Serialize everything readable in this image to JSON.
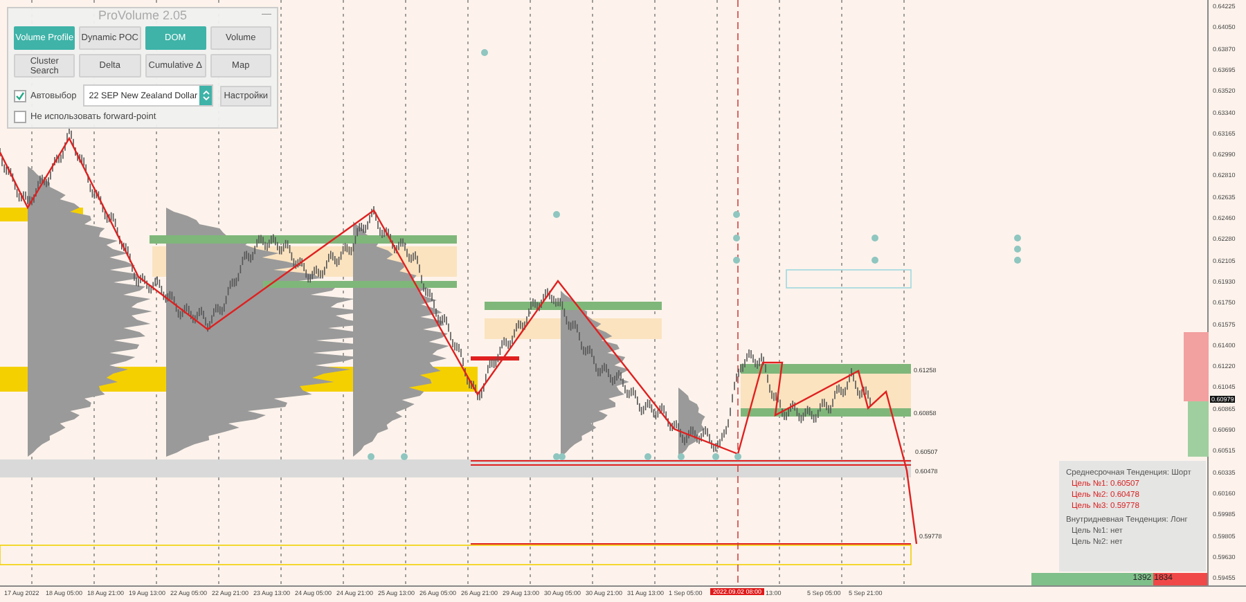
{
  "panel": {
    "title": "ProVolume 2.05",
    "minimize": "—",
    "buttons": [
      {
        "label": "Volume Profile",
        "on": true
      },
      {
        "label": "Dynamic POC",
        "on": false
      },
      {
        "label": "DOM",
        "on": true
      },
      {
        "label": "Volume",
        "on": false
      },
      {
        "label": "Cluster Search",
        "on": false
      },
      {
        "label": "Delta",
        "on": false
      },
      {
        "label": "Cumulative Δ",
        "on": false
      },
      {
        "label": "Map",
        "on": false
      }
    ],
    "auto_select": {
      "label": "Автовыбор",
      "checked": true
    },
    "instrument": {
      "value": "22 SEP New Zealand Dollar"
    },
    "settings_button": "Настройки",
    "forward_point": {
      "label": "Не использовать forward-point",
      "checked": false
    }
  },
  "chart_labels": [
    "0.61258",
    "0.60858",
    "0.60507",
    "0.60478",
    "0.59778"
  ],
  "tendency": [
    {
      "kind": "heading",
      "text": "Среднесрочная Тенденция: Шорт"
    },
    {
      "kind": "target",
      "text": "Цель №1: 0.60507"
    },
    {
      "kind": "target",
      "text": "Цель №2: 0.60478"
    },
    {
      "kind": "target",
      "text": "Цель №3: 0.59778"
    },
    {
      "kind": "heading",
      "text": "Внутридневная Тенденция: Лонг"
    },
    {
      "kind": "empty",
      "text": "Цель №1: нет"
    },
    {
      "kind": "empty",
      "text": "Цель №2: нет"
    }
  ],
  "volume_balance": {
    "buy": "1392",
    "sell": "1834",
    "level": 0.69
  },
  "price_axis": [
    "0.64225",
    "0.64050",
    "0.63870",
    "0.63695",
    "0.63520",
    "0.63340",
    "0.63165",
    "0.62990",
    "0.62810",
    "0.62635",
    "0.62460",
    "0.62280",
    "0.62105",
    "0.61930",
    "0.61750",
    "0.61575",
    "0.61400",
    "0.61220",
    "0.61045",
    "0.60865",
    "0.60690",
    "0.60515",
    "0.60335",
    "0.60160",
    "0.59985",
    "0.59805",
    "0.59630",
    "0.59455"
  ],
  "current_price": "0.60979",
  "time_axis": [
    {
      "label": "17 Aug 2022",
      "kind": "tick"
    },
    {
      "label": "18 Aug 05:00",
      "kind": "tick"
    },
    {
      "label": "18 Aug 21:00",
      "kind": "tick"
    },
    {
      "label": "19 Aug 13:00",
      "kind": "tick"
    },
    {
      "label": "22 Aug 05:00",
      "kind": "tick"
    },
    {
      "label": "22 Aug 21:00",
      "kind": "tick"
    },
    {
      "label": "23 Aug 13:00",
      "kind": "tick"
    },
    {
      "label": "24 Aug 05:00",
      "kind": "tick"
    },
    {
      "label": "24 Aug 21:00",
      "kind": "tick"
    },
    {
      "label": "25 Aug 13:00",
      "kind": "tick"
    },
    {
      "label": "26 Aug 05:00",
      "kind": "tick"
    },
    {
      "label": "26 Aug 21:00",
      "kind": "tick"
    },
    {
      "label": "29 Aug 13:00",
      "kind": "tick"
    },
    {
      "label": "30 Aug 05:00",
      "kind": "tick"
    },
    {
      "label": "30 Aug 21:00",
      "kind": "tick"
    },
    {
      "label": "31 Aug 13:00",
      "kind": "tick"
    },
    {
      "label": "1 Sep 05:00",
      "kind": "tick"
    },
    {
      "label": "2022.09.02 08:00",
      "kind": "cursor"
    },
    {
      "label": "13:00",
      "kind": "tick"
    },
    {
      "label": "5 Sep 05:00",
      "kind": "tick"
    },
    {
      "label": "5 Sep 21:00",
      "kind": "tick"
    }
  ]
}
